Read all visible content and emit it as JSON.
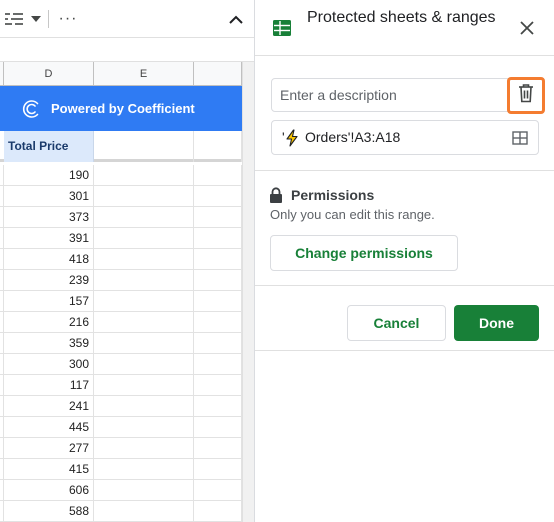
{
  "toolbar": {
    "icons": [
      "filter-views-icon",
      "caret-down-icon",
      "more-vert-icon",
      "chevron-up-icon"
    ],
    "more_label": "···"
  },
  "sheet": {
    "columns": [
      "",
      "D",
      "E",
      ""
    ],
    "banner_text": "Powered by Coefficient",
    "header_cell": "Total Price",
    "values": [
      "190",
      "301",
      "373",
      "391",
      "418",
      "239",
      "157",
      "216",
      "359",
      "300",
      "117",
      "241",
      "445",
      "277",
      "415",
      "606",
      "588"
    ],
    "banner_color": "#2f7bf3"
  },
  "panel": {
    "title": "Protected sheets & ranges",
    "description_placeholder": "Enter a description",
    "description_value": "",
    "range_prefix": "'",
    "range_text": "Orders'!A3:A18",
    "permissions_heading": "Permissions",
    "permissions_desc": "Only you can edit this range.",
    "change_permissions_label": "Change permissions",
    "cancel_label": "Cancel",
    "done_label": "Done"
  },
  "colors": {
    "accent_green": "#188038",
    "highlight_orange": "#f47c30",
    "header_cell_bg": "#dce9fb"
  }
}
